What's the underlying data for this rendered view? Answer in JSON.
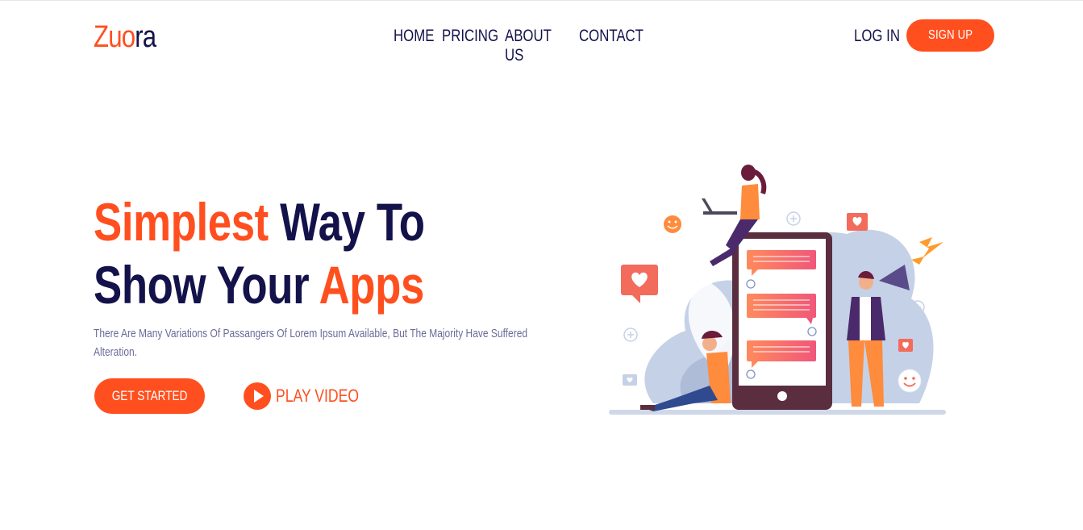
{
  "brand": {
    "part1": "Zuo",
    "part2": "ra"
  },
  "nav": {
    "items": [
      {
        "label": "HOME"
      },
      {
        "label": "PRICING"
      },
      {
        "label": "ABOUT US"
      },
      {
        "label": "CONTACT"
      }
    ]
  },
  "auth": {
    "login_label": "LOG IN",
    "signup_label": "SIGN UP"
  },
  "hero": {
    "title_line1_accent": "Simplest",
    "title_line1_rest": " Way To",
    "title_line2_rest": "Show Your ",
    "title_line2_accent": "Apps",
    "description": "There Are Many Variations Of Passangers Of Lorem Ipsum Available, But The Majority Have Suffered Alteration.",
    "cta_primary": "GET STARTED",
    "cta_secondary": "PLAY VIDEO"
  },
  "colors": {
    "accent": "#ff4f1f",
    "dark": "#14124a",
    "muted": "#6b6a9b"
  },
  "icons": [
    "play-icon",
    "heart-icon",
    "smile-icon",
    "megaphone-icon",
    "plus-circle-icon",
    "lightning-icon",
    "chat-bubble-icon",
    "user-icon"
  ]
}
